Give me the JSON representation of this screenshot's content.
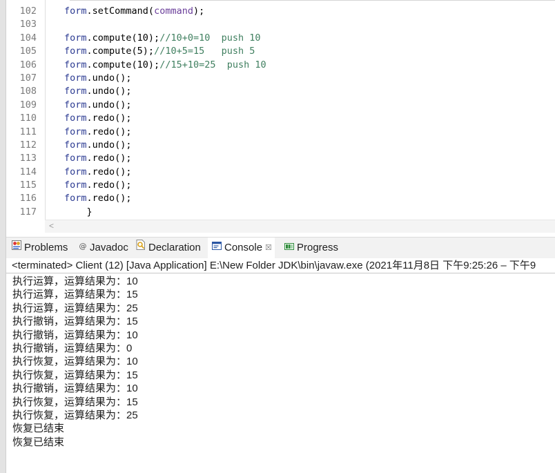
{
  "editor": {
    "lines": [
      {
        "num": "102",
        "parts": [
          {
            "t": "form",
            "c": "obj"
          },
          {
            "t": ".setCommand(",
            "c": "plain"
          },
          {
            "t": "command",
            "c": "var"
          },
          {
            "t": ");",
            "c": "plain"
          }
        ]
      },
      {
        "num": "103",
        "parts": []
      },
      {
        "num": "104",
        "parts": [
          {
            "t": "form",
            "c": "obj"
          },
          {
            "t": ".compute(10);",
            "c": "plain"
          },
          {
            "t": "//10+0=10  push 10",
            "c": "com"
          }
        ]
      },
      {
        "num": "105",
        "parts": [
          {
            "t": "form",
            "c": "obj"
          },
          {
            "t": ".compute(5);",
            "c": "plain"
          },
          {
            "t": "//10+5=15   push 5",
            "c": "com"
          }
        ]
      },
      {
        "num": "106",
        "parts": [
          {
            "t": "form",
            "c": "obj"
          },
          {
            "t": ".compute(10);",
            "c": "plain"
          },
          {
            "t": "//15+10=25  push 10",
            "c": "com"
          }
        ]
      },
      {
        "num": "107",
        "parts": [
          {
            "t": "form",
            "c": "obj"
          },
          {
            "t": ".undo();",
            "c": "plain"
          }
        ]
      },
      {
        "num": "108",
        "parts": [
          {
            "t": "form",
            "c": "obj"
          },
          {
            "t": ".undo();",
            "c": "plain"
          }
        ]
      },
      {
        "num": "109",
        "parts": [
          {
            "t": "form",
            "c": "obj"
          },
          {
            "t": ".undo();",
            "c": "plain"
          }
        ]
      },
      {
        "num": "110",
        "parts": [
          {
            "t": "form",
            "c": "obj"
          },
          {
            "t": ".redo();",
            "c": "plain"
          }
        ]
      },
      {
        "num": "111",
        "parts": [
          {
            "t": "form",
            "c": "obj"
          },
          {
            "t": ".redo();",
            "c": "plain"
          }
        ]
      },
      {
        "num": "112",
        "parts": [
          {
            "t": "form",
            "c": "obj"
          },
          {
            "t": ".undo();",
            "c": "plain"
          }
        ]
      },
      {
        "num": "113",
        "parts": [
          {
            "t": "form",
            "c": "obj"
          },
          {
            "t": ".redo();",
            "c": "plain"
          }
        ]
      },
      {
        "num": "114",
        "parts": [
          {
            "t": "form",
            "c": "obj"
          },
          {
            "t": ".redo();",
            "c": "plain"
          }
        ]
      },
      {
        "num": "115",
        "parts": [
          {
            "t": "form",
            "c": "obj"
          },
          {
            "t": ".redo();",
            "c": "plain"
          }
        ]
      },
      {
        "num": "116",
        "parts": [
          {
            "t": "form",
            "c": "obj"
          },
          {
            "t": ".redo();",
            "c": "plain"
          }
        ]
      },
      {
        "num": "117",
        "parts": [
          {
            "t": "    }",
            "c": "plain"
          }
        ]
      }
    ],
    "scroll_left_glyph": "<"
  },
  "tabs": {
    "problems": {
      "label": "Problems",
      "icon": "problems-icon"
    },
    "javadoc": {
      "label": "Javadoc",
      "icon": "at-icon"
    },
    "declaration": {
      "label": "Declaration",
      "icon": "declaration-icon"
    },
    "console": {
      "label": "Console",
      "icon": "console-icon",
      "close": "☒"
    },
    "progress": {
      "label": "Progress",
      "icon": "progress-icon"
    }
  },
  "console": {
    "status": "<terminated> Client (12) [Java Application] E:\\New Folder JDK\\bin\\javaw.exe  (2021年11月8日 下午9:25:26 – 下午9",
    "lines": [
      "执行运算，运算结果为：10",
      "执行运算，运算结果为：15",
      "执行运算，运算结果为：25",
      "执行撤销，运算结果为：15",
      "执行撤销，运算结果为：10",
      "执行撤销，运算结果为：0",
      "执行恢复，运算结果为：10",
      "执行恢复，运算结果为：15",
      "执行撤销，运算结果为：10",
      "执行恢复，运算结果为：15",
      "执行恢复，运算结果为：25",
      "恢复已结束",
      "恢复已结束"
    ]
  },
  "colors": {
    "object": "#2b3a92",
    "variable": "#6a3e9a",
    "comment": "#3f7f5f",
    "line_number": "#7a7a7a"
  }
}
